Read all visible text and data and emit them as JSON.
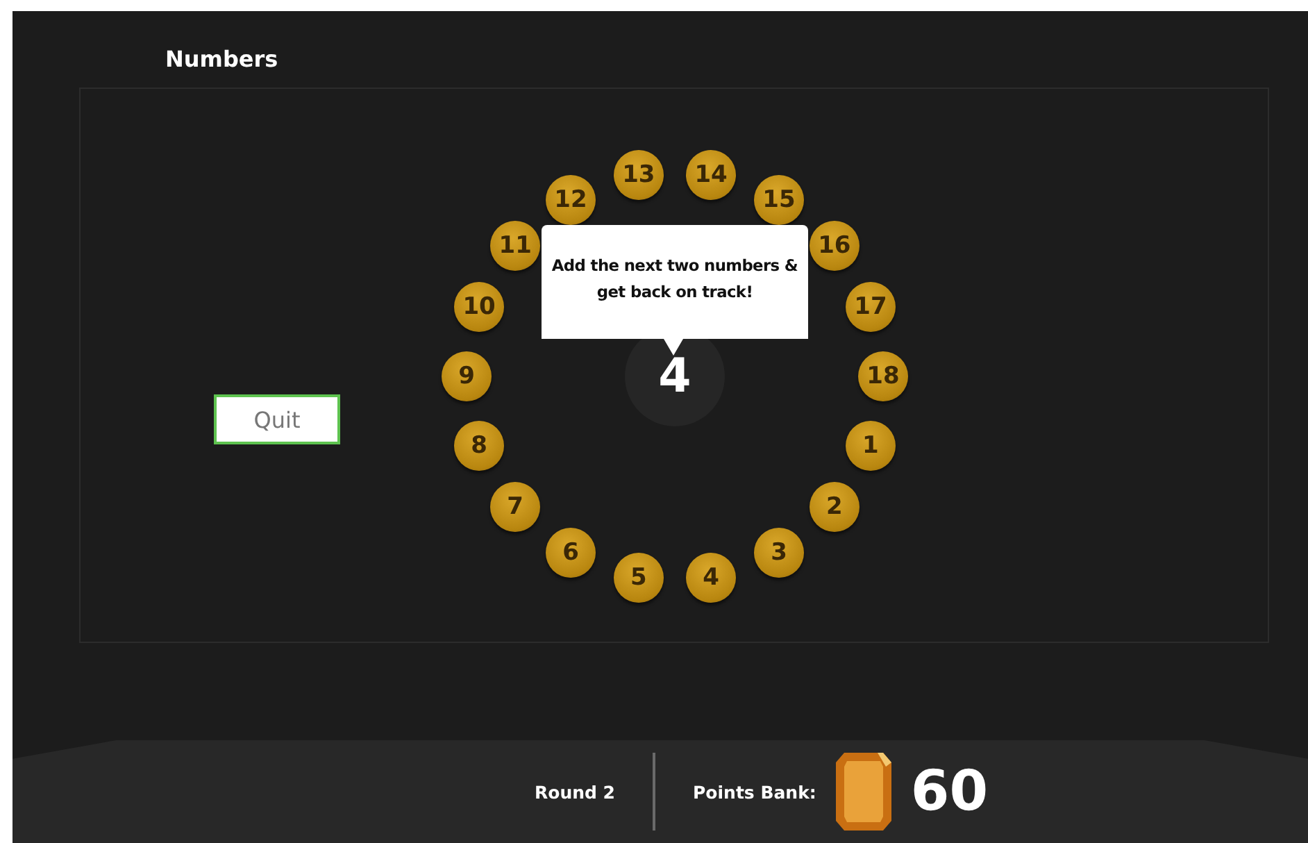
{
  "title": "Numbers",
  "quit_button": "Quit",
  "wheel": {
    "coins": [
      "1",
      "2",
      "3",
      "4",
      "5",
      "6",
      "7",
      "8",
      "9",
      "10",
      "11",
      "12",
      "13",
      "14",
      "15",
      "16",
      "17",
      "18"
    ],
    "center": "4",
    "callout": "Add the next two numbers & get back on track!"
  },
  "footer": {
    "round": "Round 2",
    "points_label": "Points Bank:",
    "points": "60"
  }
}
